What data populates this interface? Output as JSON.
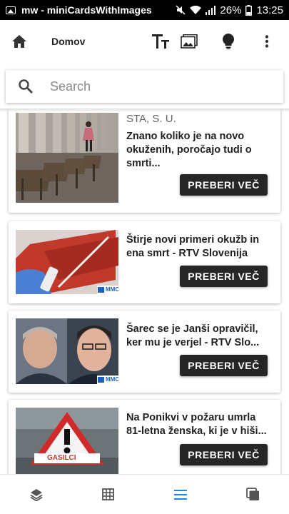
{
  "status_bar": {
    "app_label": "mw - miniCardsWithImages",
    "battery": "26%",
    "time": "13:25"
  },
  "app_bar": {
    "title": "Domov",
    "icons": [
      "home-icon",
      "text-size-icon",
      "image-icon",
      "lightbulb-icon",
      "more-vert-icon"
    ]
  },
  "search": {
    "placeholder": "Search",
    "value": ""
  },
  "articles": [
    {
      "source": "STA, S. U.",
      "headline": "Znano koliko je na novo okuženih, poročajo tudi o smrti...",
      "button": "PREBERI VEČ"
    },
    {
      "source": "",
      "headline": "Štirje novi primeri okužb in ena smrt - RTV Slovenija",
      "button": "PREBERI VEČ"
    },
    {
      "source": "",
      "headline": "Šarec se je Janši opravičil, ker mu je verjel - RTV Slo...",
      "button": "PREBERI VEČ"
    },
    {
      "source": "",
      "headline": "Na Ponikvi v požaru umrla 81-letna ženska, ki je v hiši...",
      "button": "PREBERI VEČ"
    }
  ],
  "thumb_text": {
    "mmc": "MMC",
    "sign": "GASILCI"
  },
  "bottom_nav": {
    "icons": [
      "layers-icon",
      "grid-icon",
      "list-icon",
      "cards-icon"
    ],
    "active_color": "#1e88e5",
    "inactive_color": "#555555"
  }
}
